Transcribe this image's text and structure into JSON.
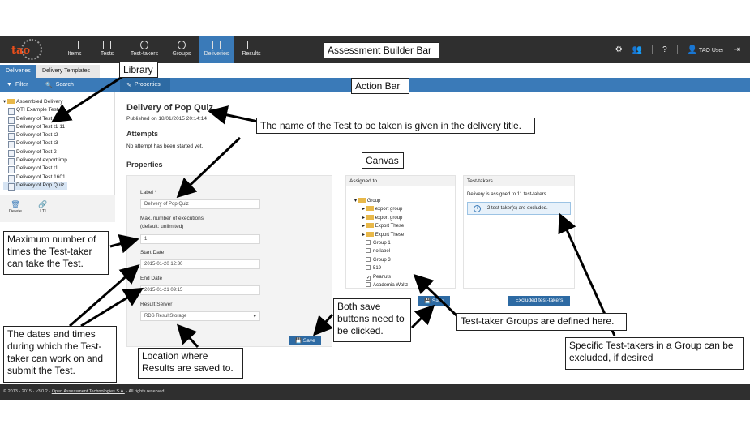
{
  "topbar": {
    "logo": "tao",
    "nav": [
      {
        "label": "Items"
      },
      {
        "label": "Tests"
      },
      {
        "label": "Test-takers"
      },
      {
        "label": "Groups"
      },
      {
        "label": "Deliveries"
      },
      {
        "label": "Results"
      }
    ],
    "user": "TAO User",
    "help": "?"
  },
  "tabs": {
    "deliveries": "Deliveries",
    "templates": "Delivery Templates"
  },
  "actionbar": {
    "filter": "Filter",
    "search": "Search",
    "properties": "Properties"
  },
  "tree": {
    "root": "Assembled Delivery",
    "items": [
      "QTI Example Test",
      "Delivery of Test t1",
      "Delivery of Test t1 11",
      "Delivery of Test t2",
      "Delivery of Test t3",
      "Delivery of Test 2",
      "Delivery of export imp",
      "Delivery of Test t1",
      "Delivery of Test 1601",
      "Delivery of Pop Quiz"
    ]
  },
  "sidebar_actions": {
    "delete": "Delete",
    "lti": "LTI"
  },
  "content": {
    "title": "Delivery of Pop Quiz",
    "published": "Published on 18/01/2015 20:14:14",
    "attempts_heading": "Attempts",
    "no_attempt": "No attempt has been started yet.",
    "properties_heading": "Properties"
  },
  "form": {
    "label_label": "Label *",
    "label_value": "Delivery of Pop Quiz",
    "max_label": "Max. number of executions",
    "max_sub": "(default: unlimited)",
    "max_value": "1",
    "start_label": "Start Date",
    "start_value": "2015-01-20 12:30",
    "end_label": "End Date",
    "end_value": "2015-01-21 09:15",
    "server_label": "Result Server",
    "server_value": "RDS ResultStorage",
    "save": "Save"
  },
  "assigned": {
    "heading": "Assigned to",
    "root": "Group",
    "folders": [
      "export group",
      "export group",
      "Export These",
      "Export These"
    ],
    "groups": [
      {
        "label": "Group 1",
        "checked": false
      },
      {
        "label": "no label",
        "checked": false
      },
      {
        "label": "Group 3",
        "checked": false
      },
      {
        "label": "519",
        "checked": false
      },
      {
        "label": "Peanuts",
        "checked": true
      },
      {
        "label": "Academia Waltz",
        "checked": false
      }
    ],
    "save": "Save"
  },
  "testtakers": {
    "heading": "Test-takers",
    "assigned_text": "Delivery is assigned to 11 test-takers.",
    "excluded_text": "2 test-taker(s) are excluded.",
    "excluded_button": "Excluded test-takers"
  },
  "footer": {
    "text_pre": "© 2013 - 2015 · v3.0.2 · ",
    "link": "Open Assessment Technologies S.A.",
    "text_post": " · All rights reserved."
  },
  "callouts": {
    "builder_bar": "Assessment Builder Bar",
    "library": "Library",
    "action_bar": "Action Bar",
    "title_note": "The name of the Test to be taken is given in the delivery title.",
    "canvas": "Canvas",
    "max_note": "Maximum number of times the Test-taker can take the Test.",
    "dates_note": "The dates and times during which the Test-taker can work on and submit the Test.",
    "location_note": "Location where Results are saved to.",
    "save_note": "Both save buttons need to be clicked.",
    "groups_note": "Test-taker Groups are defined here.",
    "exclude_note": "Specific Test-takers in a Group can be excluded, if desired"
  }
}
